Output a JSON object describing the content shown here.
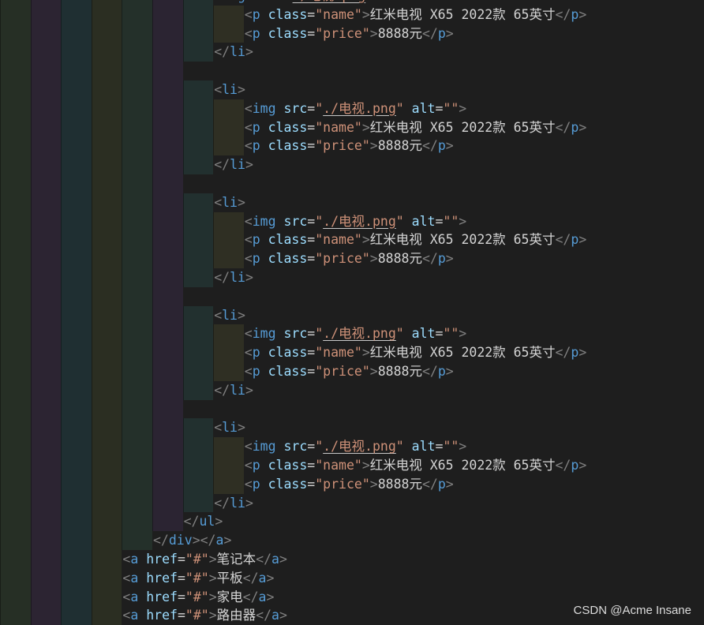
{
  "colors": {
    "background": "#1e1e1e",
    "tag": "#569cd6",
    "angle_bracket": "#808080",
    "attribute": "#9cdcfe",
    "string": "#ce9178",
    "text": "#d4d4d4",
    "indent_guides": [
      "#262f25",
      "#2c2432",
      "#1f2f32",
      "#2b2e22",
      "#24302a",
      "#2b2432",
      "#22302f",
      "#2f2f23"
    ]
  },
  "lines": [
    {
      "indent": 7,
      "code": "<img src=\"./电视.png\" alt=\"\">"
    },
    {
      "indent": 8,
      "code": "<p class=\"name\">红米电视 X65 2022款 65英寸</p>"
    },
    {
      "indent": 8,
      "code": "<p class=\"price\">8888元</p>"
    },
    {
      "indent": 7,
      "code": "</li>"
    },
    {
      "indent": 6,
      "code": ""
    },
    {
      "indent": 7,
      "code": "<li>"
    },
    {
      "indent": 8,
      "code": "<img src=\"./电视.png\" alt=\"\">"
    },
    {
      "indent": 8,
      "code": "<p class=\"name\">红米电视 X65 2022款 65英寸</p>"
    },
    {
      "indent": 8,
      "code": "<p class=\"price\">8888元</p>"
    },
    {
      "indent": 7,
      "code": "</li>"
    },
    {
      "indent": 6,
      "code": ""
    },
    {
      "indent": 7,
      "code": "<li>"
    },
    {
      "indent": 8,
      "code": "<img src=\"./电视.png\" alt=\"\">"
    },
    {
      "indent": 8,
      "code": "<p class=\"name\">红米电视 X65 2022款 65英寸</p>"
    },
    {
      "indent": 8,
      "code": "<p class=\"price\">8888元</p>"
    },
    {
      "indent": 7,
      "code": "</li>"
    },
    {
      "indent": 6,
      "code": ""
    },
    {
      "indent": 7,
      "code": "<li>"
    },
    {
      "indent": 8,
      "code": "<img src=\"./电视.png\" alt=\"\">"
    },
    {
      "indent": 8,
      "code": "<p class=\"name\">红米电视 X65 2022款 65英寸</p>"
    },
    {
      "indent": 8,
      "code": "<p class=\"price\">8888元</p>"
    },
    {
      "indent": 7,
      "code": "</li>"
    },
    {
      "indent": 6,
      "code": ""
    },
    {
      "indent": 7,
      "code": "<li>"
    },
    {
      "indent": 8,
      "code": "<img src=\"./电视.png\" alt=\"\">"
    },
    {
      "indent": 8,
      "code": "<p class=\"name\">红米电视 X65 2022款 65英寸</p>"
    },
    {
      "indent": 8,
      "code": "<p class=\"price\">8888元</p>"
    },
    {
      "indent": 7,
      "code": "</li>"
    },
    {
      "indent": 6,
      "code": "</ul>"
    },
    {
      "indent": 5,
      "code": "</div></a>"
    },
    {
      "indent": 4,
      "code": "<a href=\"#\">笔记本</a>"
    },
    {
      "indent": 4,
      "code": "<a href=\"#\">平板</a>"
    },
    {
      "indent": 4,
      "code": "<a href=\"#\">家电</a>"
    },
    {
      "indent": 4,
      "code": "<a href=\"#\">路由器</a>"
    }
  ],
  "watermark": "CSDN @Acme Insane"
}
